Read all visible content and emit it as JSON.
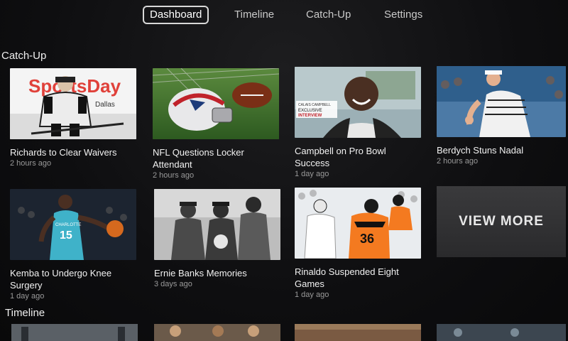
{
  "nav": {
    "tabs": [
      {
        "label": "Dashboard",
        "active": true
      },
      {
        "label": "Timeline",
        "active": false
      },
      {
        "label": "Catch-Up",
        "active": false
      },
      {
        "label": "Settings",
        "active": false
      }
    ]
  },
  "catchup": {
    "title": "Catch-Up",
    "items": [
      {
        "title": "Richards to Clear Waivers",
        "time": "2 hours ago",
        "thumb": {
          "logo_text": "SportsDay",
          "sub_text": "Dallas"
        }
      },
      {
        "title": "NFL Questions Locker Attendant",
        "time": "2 hours ago"
      },
      {
        "title": "Campbell on Pro Bowl Success",
        "time": "1 day ago",
        "thumb": {
          "caption_name": "CALAIS CAMPBELL",
          "caption_sub": "EXCLUSIVE",
          "caption_tag": "INTERVIEW"
        }
      },
      {
        "title": "Berdych Stuns Nadal",
        "time": "2 hours ago"
      },
      {
        "title": "Kemba to Undergo Knee Surgery",
        "time": "1 day ago",
        "thumb": {
          "jersey_text": "CHARLOTTE",
          "jersey_number": "15"
        }
      },
      {
        "title": "Ernie Banks Memories",
        "time": "3 days ago"
      },
      {
        "title": "Rinaldo Suspended Eight Games",
        "time": "1 day ago",
        "thumb": {
          "jersey_number": "36"
        }
      }
    ],
    "view_more_label": "VIEW MORE"
  },
  "timeline": {
    "title": "Timeline"
  },
  "colors": {
    "accent": "#ffffff",
    "background": "#0e0e10",
    "muted_text": "#9a9a9a"
  }
}
